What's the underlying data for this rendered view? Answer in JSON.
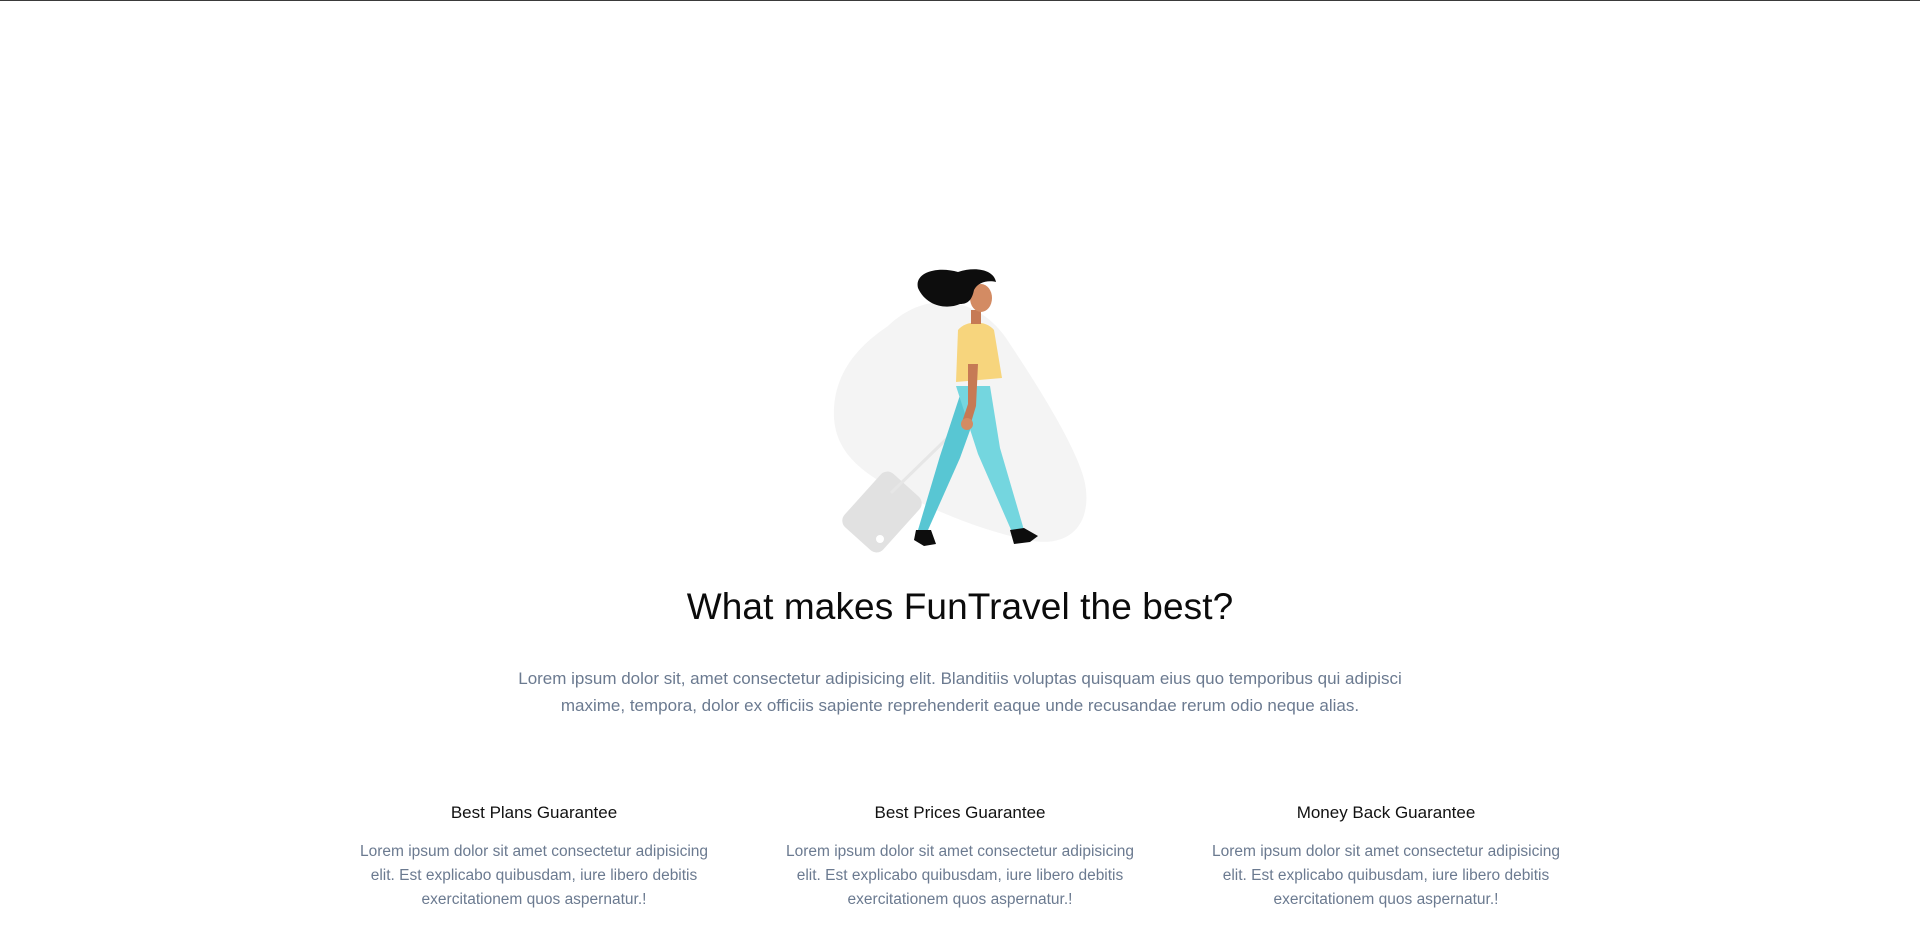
{
  "why_section": {
    "illustration_icon": "traveler-with-suitcase-illustration",
    "heading": "What makes FunTravel the best?",
    "intro": "Lorem ipsum dolor sit, amet consectetur adipisicing elit. Blanditiis voluptas quisquam eius quo temporibus qui adipisci maxime, tempora, dolor ex officiis sapiente reprehenderit eaque unde recusandae rerum odio neque alias.",
    "features": [
      {
        "title": "Best Plans Guarantee",
        "text": "Lorem ipsum dolor sit amet consectetur adipisicing elit. Est explicabo quibusdam, iure libero debitis exercitationem quos aspernatur.!"
      },
      {
        "title": "Best Prices Guarantee",
        "text": "Lorem ipsum dolor sit amet consectetur adipisicing elit. Est explicabo quibusdam, iure libero debitis exercitationem quos aspernatur.!"
      },
      {
        "title": "Money Back Guarantee",
        "text": "Lorem ipsum dolor sit amet consectetur adipisicing elit. Est explicabo quibusdam, iure libero debitis exercitationem quos aspernatur.!"
      }
    ]
  },
  "colors": {
    "heading": "#0b0b0b",
    "body_text": "#6b7a90",
    "shirt": "#f7d57d",
    "pants": "#6dd2dc",
    "skin": "#d38b63",
    "hair": "#0d0d0d",
    "suitcase": "#e1e1e1",
    "blob": "#f4f4f4"
  }
}
